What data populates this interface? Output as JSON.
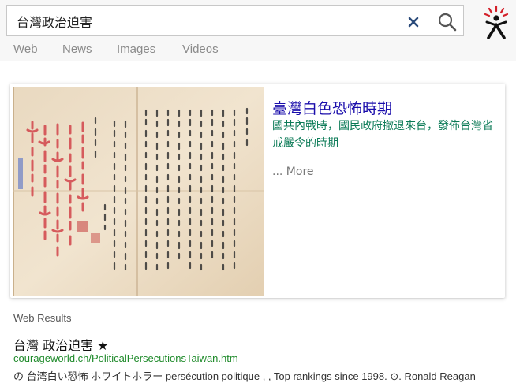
{
  "search": {
    "query": "台灣政治迫害"
  },
  "tabs": [
    {
      "label": "Web",
      "active": true
    },
    {
      "label": "News",
      "active": false
    },
    {
      "label": "Images",
      "active": false
    },
    {
      "label": "Videos",
      "active": false
    }
  ],
  "icons": {
    "clear": "close-icon",
    "search": "search-icon",
    "logo": "brand-logo"
  },
  "colors": {
    "link": "#1a0dab",
    "url": "#1e8a2a",
    "desc": "#0a7a56"
  },
  "card": {
    "title": "臺灣白色恐怖時期",
    "description": "國共內戰時，國民政府撤退來台，發佈台灣省戒嚴令的時期",
    "more": "... More"
  },
  "results_label": "Web Results",
  "results": [
    {
      "title": "台灣 政治迫害 ★",
      "url": "courageworld.ch/PoliticalPersecutionsTaiwan.htm",
      "snippet": "の 台湾白い恐怖 ホワイトホラー persécution politique , , Top rankings since 1998. ⊙. Ronald Reagan"
    }
  ]
}
